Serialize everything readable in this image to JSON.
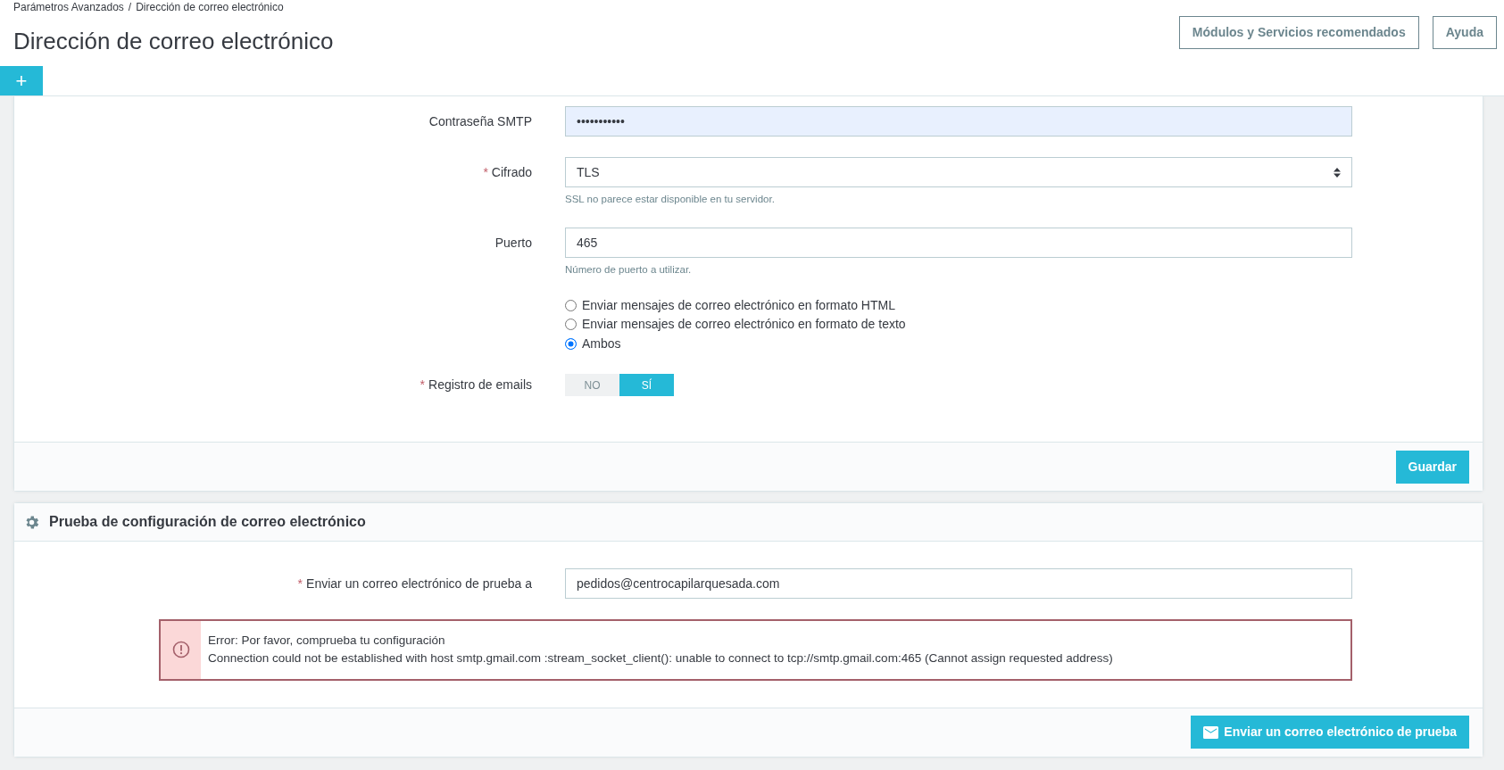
{
  "breadcrumb": [
    "Parámetros Avanzados",
    "Dirección de correo electrónico"
  ],
  "breadcrumb_separator": "/",
  "page_title": "Dirección de correo electrónico",
  "toolbar_buttons": [
    "Módulos y Servicios recomendados",
    "Ayuda"
  ],
  "add_tab": {
    "label": "+"
  },
  "settings_form": {
    "fields": [
      {
        "kind": "password",
        "label": "Contraseña SMTP",
        "value": "•••••••••••",
        "autofilled": true
      },
      {
        "kind": "select",
        "label": "Cifrado",
        "required_mark": "*",
        "value": "TLS",
        "help": "SSL no parece estar disponible en tu servidor."
      },
      {
        "kind": "text",
        "label": "Puerto",
        "value": "465",
        "help": "Número de puerto a utilizar."
      },
      {
        "kind": "radios",
        "options": [
          {
            "label": "Enviar mensajes de correo electrónico en formato HTML",
            "selected": false
          },
          {
            "label": "Enviar mensajes de correo electrónico en formato de texto",
            "selected": false
          },
          {
            "label": "Ambos",
            "selected": true
          }
        ]
      },
      {
        "kind": "switch",
        "label": "Registro de emails",
        "required_mark": "*",
        "options": [
          {
            "label": "NO",
            "selected": false
          },
          {
            "label": "SÍ",
            "selected": true
          }
        ]
      }
    ],
    "save_button": "Guardar"
  },
  "test_panel": {
    "title": "Prueba de configuración de correo electrónico",
    "fields": [
      {
        "kind": "text",
        "label": "Enviar un correo electrónico de prueba a",
        "required_mark": "*",
        "value": "pedidos@centrocapilarquesada.com"
      }
    ],
    "alert": {
      "lines": [
        "Error: Por favor, comprueba tu configuración",
        "Connection could not be established with host smtp.gmail.com :stream_socket_client(): unable to connect to tcp://smtp.gmail.com:465 (Cannot assign requested address)"
      ]
    },
    "send_button": "Enviar un correo electrónico de prueba"
  }
}
